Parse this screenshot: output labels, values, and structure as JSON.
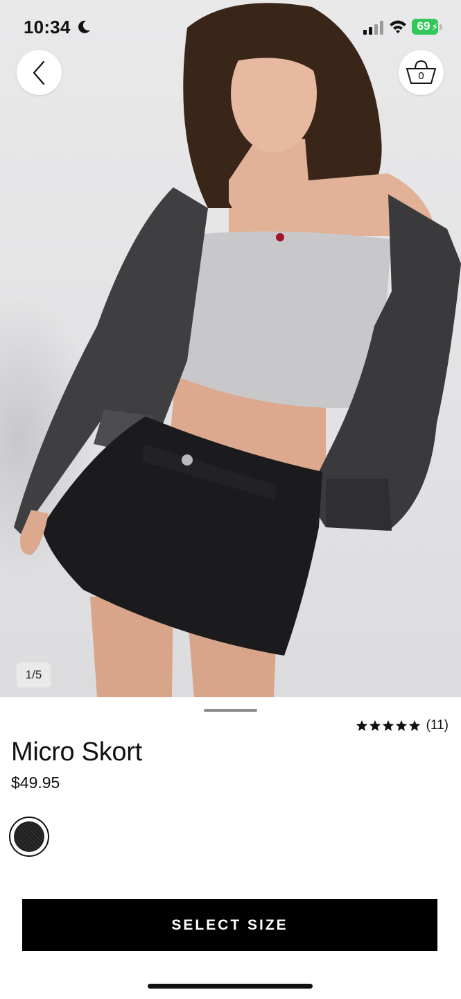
{
  "status_bar": {
    "time": "10:34",
    "battery_level": "69",
    "icons": [
      "moon-icon",
      "cellular-signal-icon",
      "wifi-icon",
      "battery-charging-icon"
    ]
  },
  "header": {
    "back_icon": "chevron-left-icon",
    "bag_icon": "shopping-basket-icon",
    "bag_count": "0"
  },
  "gallery": {
    "counter": "1/5"
  },
  "product": {
    "rating_stars": 5,
    "rating_count": "(11)",
    "title": "Micro Skort",
    "price": "$49.95",
    "swatch_color": "#1f1f1f"
  },
  "actions": {
    "select_size_label": "SELECT SIZE"
  },
  "colors": {
    "accent": "#000000",
    "battery": "#33c759"
  }
}
